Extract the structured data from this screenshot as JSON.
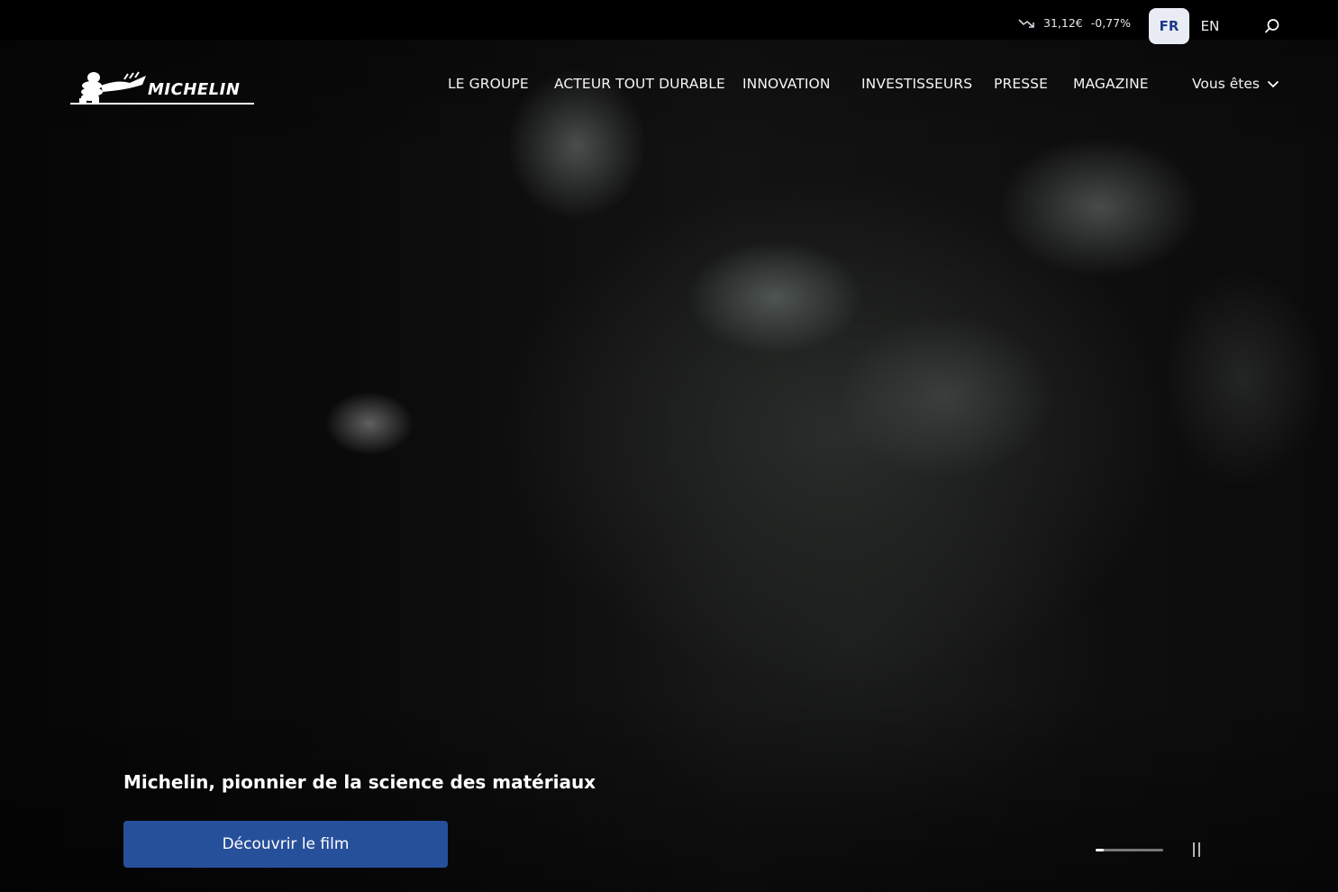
{
  "topbar": {
    "stock": {
      "trend_icon": "trend-down-icon",
      "price": "31,12€",
      "change": "-0,77%"
    },
    "languages": {
      "active": "FR",
      "other": "EN"
    },
    "search_icon": "search-icon"
  },
  "brand": {
    "logo_text": "MICHELIN"
  },
  "nav": {
    "items": [
      {
        "label": "LE GROUPE"
      },
      {
        "label": "ACTEUR TOUT DURABLE"
      },
      {
        "label": "INNOVATION"
      },
      {
        "label": "INVESTISSEURS"
      },
      {
        "label": "PRESSE"
      },
      {
        "label": "MAGAZINE"
      }
    ],
    "audience_dropdown": {
      "label": "Vous êtes",
      "icon": "chevron-down-icon"
    }
  },
  "hero": {
    "headline": "Michelin, pionnier de la science des matériaux",
    "cta_label": "Découvrir le film",
    "slider": {
      "progress": 0.12,
      "pause_icon": "pause-icon"
    }
  },
  "colors": {
    "cta_bg": "#27509b",
    "lang_active_bg": "#e9ecf4",
    "lang_active_text": "#1e3a8a",
    "topbar_bg": "#000000"
  }
}
